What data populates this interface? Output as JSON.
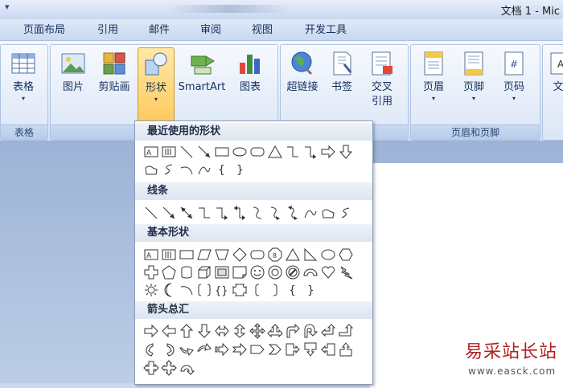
{
  "window": {
    "quick_access": "▾",
    "doc_title": "文档 1 - Mic"
  },
  "tabs": [
    {
      "label": "页面布局"
    },
    {
      "label": "引用"
    },
    {
      "label": "邮件"
    },
    {
      "label": "审阅"
    },
    {
      "label": "视图"
    },
    {
      "label": "开发工具"
    }
  ],
  "ribbon": {
    "groups": [
      {
        "label": "表格"
      },
      {
        "label": ""
      },
      {
        "label": ""
      },
      {
        "label": "页眉和页脚"
      }
    ],
    "buttons": {
      "table": {
        "label": "表格",
        "arrow": "▾"
      },
      "picture": {
        "label": "图片"
      },
      "clipart": {
        "label": "剪贴画"
      },
      "shapes": {
        "label": "形状",
        "arrow": "▾"
      },
      "smartart": {
        "label": "SmartArt"
      },
      "chart": {
        "label": "图表"
      },
      "hyperlink": {
        "label": "超链接"
      },
      "bookmark": {
        "label": "书签"
      },
      "crossref": {
        "label": "交叉\n引用"
      },
      "header": {
        "label": "页眉",
        "arrow": "▾"
      },
      "footer": {
        "label": "页脚",
        "arrow": "▾"
      },
      "pagenum": {
        "label": "页码",
        "arrow": "▾"
      },
      "textbox": {
        "label": "文"
      }
    }
  },
  "shapes_menu": {
    "sections": {
      "recent": "最近使用的形状",
      "lines": "线条",
      "basic": "基本形状",
      "arrows": "箭头总汇"
    }
  },
  "watermark": {
    "text": "易采站长站",
    "url": "www.easck.com"
  },
  "colors": {
    "accent": "#ffc85a",
    "ribbon": "#dbe6f6",
    "doc_bg": "#9db3d6"
  }
}
